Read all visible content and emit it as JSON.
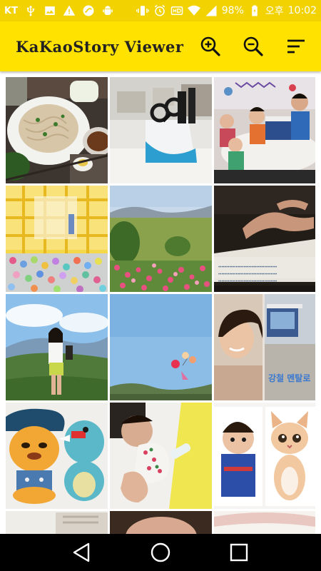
{
  "status_bar": {
    "carrier": "KT",
    "battery": "98%",
    "ampm": "오후",
    "time": "10:02",
    "background": "#f2d200"
  },
  "app_bar": {
    "title": "KaKaoStory Viewer",
    "background": "#ffe200",
    "actions": [
      {
        "name": "zoom-in-icon"
      },
      {
        "name": "zoom-out-icon"
      },
      {
        "name": "sort-icon"
      }
    ]
  },
  "grid": {
    "tiles": [
      {
        "name": "photo-noodles"
      },
      {
        "name": "photo-knife-block"
      },
      {
        "name": "photo-kids-birthday"
      },
      {
        "name": "photo-ball-pit"
      },
      {
        "name": "photo-flower-field"
      },
      {
        "name": "photo-hands-paper"
      },
      {
        "name": "photo-woman-mountain"
      },
      {
        "name": "photo-balloons-sky"
      },
      {
        "name": "photo-woman-tv-collage"
      },
      {
        "name": "photo-plush-toys"
      },
      {
        "name": "photo-baby-bottle"
      },
      {
        "name": "photo-baby-kitten-collage"
      }
    ],
    "overlay_texts": {
      "hands_paper_caption": "",
      "tv_banner": "강철 멘탈로"
    }
  },
  "nav_bar": {
    "buttons": [
      {
        "name": "back-icon"
      },
      {
        "name": "home-icon"
      },
      {
        "name": "recents-icon"
      }
    ]
  }
}
